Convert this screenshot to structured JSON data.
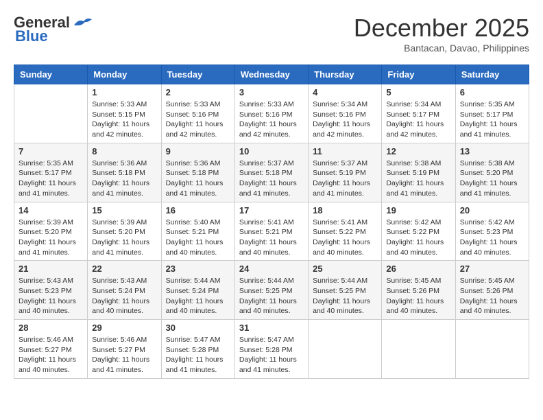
{
  "header": {
    "logo_general": "General",
    "logo_blue": "Blue",
    "month_year": "December 2025",
    "location": "Bantacan, Davao, Philippines"
  },
  "weekdays": [
    "Sunday",
    "Monday",
    "Tuesday",
    "Wednesday",
    "Thursday",
    "Friday",
    "Saturday"
  ],
  "weeks": [
    [
      {
        "day": "",
        "info": ""
      },
      {
        "day": "1",
        "info": "Sunrise: 5:33 AM\nSunset: 5:15 PM\nDaylight: 11 hours\nand 42 minutes."
      },
      {
        "day": "2",
        "info": "Sunrise: 5:33 AM\nSunset: 5:16 PM\nDaylight: 11 hours\nand 42 minutes."
      },
      {
        "day": "3",
        "info": "Sunrise: 5:33 AM\nSunset: 5:16 PM\nDaylight: 11 hours\nand 42 minutes."
      },
      {
        "day": "4",
        "info": "Sunrise: 5:34 AM\nSunset: 5:16 PM\nDaylight: 11 hours\nand 42 minutes."
      },
      {
        "day": "5",
        "info": "Sunrise: 5:34 AM\nSunset: 5:17 PM\nDaylight: 11 hours\nand 42 minutes."
      },
      {
        "day": "6",
        "info": "Sunrise: 5:35 AM\nSunset: 5:17 PM\nDaylight: 11 hours\nand 41 minutes."
      }
    ],
    [
      {
        "day": "7",
        "info": "Sunrise: 5:35 AM\nSunset: 5:17 PM\nDaylight: 11 hours\nand 41 minutes."
      },
      {
        "day": "8",
        "info": "Sunrise: 5:36 AM\nSunset: 5:18 PM\nDaylight: 11 hours\nand 41 minutes."
      },
      {
        "day": "9",
        "info": "Sunrise: 5:36 AM\nSunset: 5:18 PM\nDaylight: 11 hours\nand 41 minutes."
      },
      {
        "day": "10",
        "info": "Sunrise: 5:37 AM\nSunset: 5:18 PM\nDaylight: 11 hours\nand 41 minutes."
      },
      {
        "day": "11",
        "info": "Sunrise: 5:37 AM\nSunset: 5:19 PM\nDaylight: 11 hours\nand 41 minutes."
      },
      {
        "day": "12",
        "info": "Sunrise: 5:38 AM\nSunset: 5:19 PM\nDaylight: 11 hours\nand 41 minutes."
      },
      {
        "day": "13",
        "info": "Sunrise: 5:38 AM\nSunset: 5:20 PM\nDaylight: 11 hours\nand 41 minutes."
      }
    ],
    [
      {
        "day": "14",
        "info": "Sunrise: 5:39 AM\nSunset: 5:20 PM\nDaylight: 11 hours\nand 41 minutes."
      },
      {
        "day": "15",
        "info": "Sunrise: 5:39 AM\nSunset: 5:20 PM\nDaylight: 11 hours\nand 41 minutes."
      },
      {
        "day": "16",
        "info": "Sunrise: 5:40 AM\nSunset: 5:21 PM\nDaylight: 11 hours\nand 40 minutes."
      },
      {
        "day": "17",
        "info": "Sunrise: 5:41 AM\nSunset: 5:21 PM\nDaylight: 11 hours\nand 40 minutes."
      },
      {
        "day": "18",
        "info": "Sunrise: 5:41 AM\nSunset: 5:22 PM\nDaylight: 11 hours\nand 40 minutes."
      },
      {
        "day": "19",
        "info": "Sunrise: 5:42 AM\nSunset: 5:22 PM\nDaylight: 11 hours\nand 40 minutes."
      },
      {
        "day": "20",
        "info": "Sunrise: 5:42 AM\nSunset: 5:23 PM\nDaylight: 11 hours\nand 40 minutes."
      }
    ],
    [
      {
        "day": "21",
        "info": "Sunrise: 5:43 AM\nSunset: 5:23 PM\nDaylight: 11 hours\nand 40 minutes."
      },
      {
        "day": "22",
        "info": "Sunrise: 5:43 AM\nSunset: 5:24 PM\nDaylight: 11 hours\nand 40 minutes."
      },
      {
        "day": "23",
        "info": "Sunrise: 5:44 AM\nSunset: 5:24 PM\nDaylight: 11 hours\nand 40 minutes."
      },
      {
        "day": "24",
        "info": "Sunrise: 5:44 AM\nSunset: 5:25 PM\nDaylight: 11 hours\nand 40 minutes."
      },
      {
        "day": "25",
        "info": "Sunrise: 5:44 AM\nSunset: 5:25 PM\nDaylight: 11 hours\nand 40 minutes."
      },
      {
        "day": "26",
        "info": "Sunrise: 5:45 AM\nSunset: 5:26 PM\nDaylight: 11 hours\nand 40 minutes."
      },
      {
        "day": "27",
        "info": "Sunrise: 5:45 AM\nSunset: 5:26 PM\nDaylight: 11 hours\nand 40 minutes."
      }
    ],
    [
      {
        "day": "28",
        "info": "Sunrise: 5:46 AM\nSunset: 5:27 PM\nDaylight: 11 hours\nand 40 minutes."
      },
      {
        "day": "29",
        "info": "Sunrise: 5:46 AM\nSunset: 5:27 PM\nDaylight: 11 hours\nand 41 minutes."
      },
      {
        "day": "30",
        "info": "Sunrise: 5:47 AM\nSunset: 5:28 PM\nDaylight: 11 hours\nand 41 minutes."
      },
      {
        "day": "31",
        "info": "Sunrise: 5:47 AM\nSunset: 5:28 PM\nDaylight: 11 hours\nand 41 minutes."
      },
      {
        "day": "",
        "info": ""
      },
      {
        "day": "",
        "info": ""
      },
      {
        "day": "",
        "info": ""
      }
    ]
  ]
}
